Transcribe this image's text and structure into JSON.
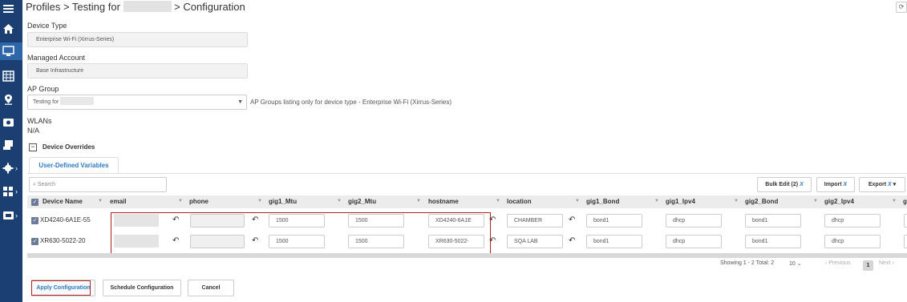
{
  "sidebar": {
    "items": [
      {
        "icon": "menu-icon"
      },
      {
        "icon": "home-icon"
      },
      {
        "icon": "monitor-icon"
      },
      {
        "icon": "table-icon"
      },
      {
        "icon": "location-pin-icon"
      },
      {
        "icon": "camera-icon"
      },
      {
        "icon": "device-user-icon"
      },
      {
        "icon": "gear-icon"
      },
      {
        "icon": "network-icon"
      },
      {
        "icon": "screen-icon"
      }
    ]
  },
  "breadcrumb": {
    "part1": "Profiles > Testing for",
    "part2": "> Configuration"
  },
  "form": {
    "device_type_label": "Device Type",
    "device_type_value": "Enterprise Wi-Fi (Xirrus-Series)",
    "managed_account_label": "Managed Account",
    "managed_account_value": "Base Infrastructure",
    "ap_group_label": "AP Group",
    "ap_group_value": "Testing for",
    "ap_group_note": "AP Groups listing only for device type - Enterprise Wi-Fi (Xirrus-Series)",
    "wlans_label": "WLANs",
    "wlans_value": "N/A",
    "device_overrides_label": "Device Overrides"
  },
  "tabs": {
    "user_defined": "User-Defined Variables"
  },
  "toolbar": {
    "search_placeholder": "Search",
    "bulk_edit": "Bulk Edit (2)",
    "import": "Import",
    "export": "Export",
    "x_mark": "X"
  },
  "table": {
    "columns": [
      "Device Name",
      "email",
      "phone",
      "gig1_Mtu",
      "gig2_Mtu",
      "hostname",
      "location",
      "gig1_Bond",
      "gig1_Ipv4",
      "gig2_Bond",
      "gig2_Ipv4",
      "g"
    ],
    "rows": [
      {
        "device_name": "XD4240-6A1E-55",
        "gig1_mtu": "1500",
        "gig2_mtu": "1500",
        "hostname": "XD4240-6A1E",
        "location": "CHAMBER",
        "gig1_bond": "bond1",
        "gig1_ipv4": "dhcp",
        "gig2_bond": "bond1",
        "gig2_ipv4": "dhcp"
      },
      {
        "device_name": "XR630-5022-20",
        "gig1_mtu": "1500",
        "gig2_mtu": "1500",
        "hostname": "XR630-5022-",
        "location": "SQA LAB",
        "gig1_bond": "bond1",
        "gig1_ipv4": "dhcp",
        "gig2_bond": "bond1",
        "gig2_ipv4": "dhcp"
      }
    ]
  },
  "pagination": {
    "summary": "Showing 1 - 2 Total: 2",
    "page_size": "10",
    "previous": "‹ Previous",
    "current_page": "1",
    "next": "Next ›"
  },
  "actions": {
    "apply": "Apply Configuration",
    "schedule": "Schedule Configuration",
    "cancel": "Cancel"
  },
  "colors": {
    "sidebar_bg": "#1b3f73",
    "accent": "#2d7bc4",
    "highlight": "#b22222"
  }
}
